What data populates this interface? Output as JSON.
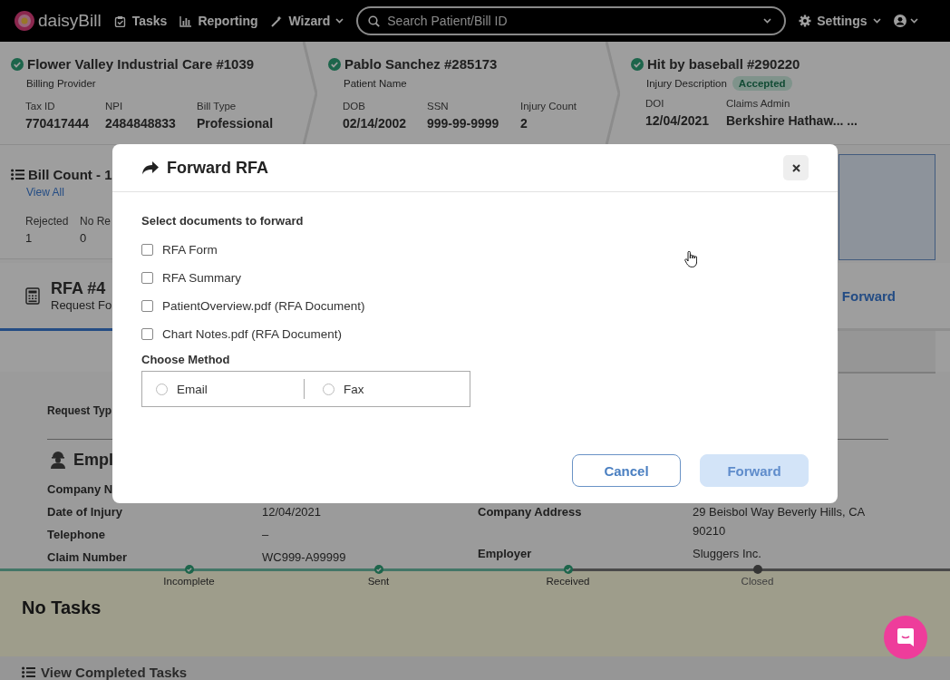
{
  "nav": {
    "logo": "daisyBill",
    "items": [
      {
        "label": "Tasks",
        "dropdown": false
      },
      {
        "label": "Reporting",
        "dropdown": false
      },
      {
        "label": "Wizard",
        "dropdown": true
      }
    ],
    "search": {
      "placeholder": "Search Patient/Bill ID"
    },
    "settings": "Settings"
  },
  "summary": [
    {
      "title": "Flower Valley Industrial Care #1039",
      "subtitle": "Billing Provider",
      "verified": true,
      "fields": [
        {
          "label": "Tax ID",
          "value": "770417444"
        },
        {
          "label": "NPI",
          "value": "2484848833"
        },
        {
          "label": "Bill Type",
          "value": "Professional"
        }
      ]
    },
    {
      "title": "Pablo Sanchez #285173",
      "subtitle": "Patient Name",
      "verified": true,
      "fields": [
        {
          "label": "DOB",
          "value": "02/14/2002"
        },
        {
          "label": "SSN",
          "value": "999-99-9999"
        },
        {
          "label": "Injury Count",
          "value": "2"
        }
      ]
    },
    {
      "title": "Hit by baseball #290220",
      "subtitle": "Injury Description",
      "badge": "Accepted",
      "verified": true,
      "fields": [
        {
          "label": "DOI",
          "value": "12/04/2021"
        },
        {
          "label": "Claims Admin",
          "value": "Berkshire Hathaw... ..."
        }
      ]
    }
  ],
  "bill_count": {
    "title": "Bill Count - 1",
    "link": "View All",
    "stats": [
      {
        "label": "Rejected",
        "value": "1"
      },
      {
        "label": "No Re",
        "value": "0"
      }
    ]
  },
  "rfa": {
    "title": "RFA #4",
    "subtitle": "Request Fo",
    "action": "Forward",
    "request_type_label": "Request Typ"
  },
  "employer": {
    "title": "Empl",
    "left": [
      {
        "label": "Company N"
      },
      {
        "label": "Date of Injury",
        "value": "12/04/2021"
      },
      {
        "label": "Telephone",
        "value": "–"
      },
      {
        "label": "Claim Number",
        "value": "WC999-A99999"
      }
    ],
    "right": [
      {
        "label": "Company Address",
        "value": "29 Beisbol Way Beverly Hills, CA 90210"
      },
      {
        "label": "Employer",
        "value": "Sluggers Inc."
      }
    ]
  },
  "stepper": [
    {
      "label": "Incomplete",
      "done": true
    },
    {
      "label": "Sent",
      "done": true
    },
    {
      "label": "Received",
      "done": true
    },
    {
      "label": "Closed",
      "done": false
    }
  ],
  "tasks": {
    "title": "No Tasks",
    "completed_link": "View Completed Tasks"
  },
  "modal": {
    "title": "Forward RFA",
    "prompt": "Select documents to forward",
    "documents": [
      {
        "label": "RFA Form",
        "checked": false
      },
      {
        "label": "RFA Summary",
        "checked": false
      },
      {
        "label": "PatientOverview.pdf (RFA Document)",
        "checked": false
      },
      {
        "label": "Chart Notes.pdf (RFA Document)",
        "checked": false
      }
    ],
    "method_label": "Choose Method",
    "methods": [
      {
        "label": "Email",
        "selected": false
      },
      {
        "label": "Fax",
        "selected": false
      }
    ],
    "buttons": [
      {
        "label": "Cancel",
        "kind": "secondary",
        "disabled": false
      },
      {
        "label": "Forward",
        "kind": "primary",
        "disabled": true
      }
    ]
  }
}
